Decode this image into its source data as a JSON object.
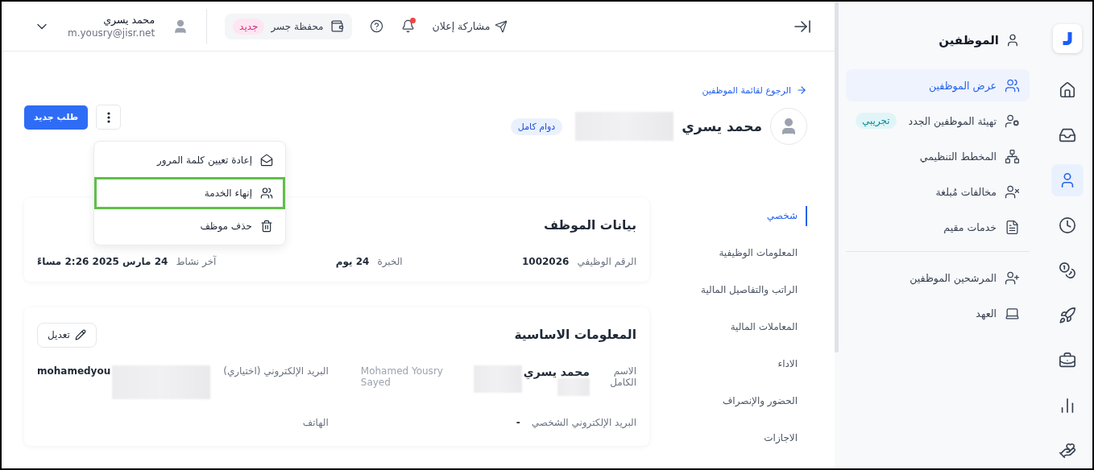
{
  "rail": {
    "items": [
      {
        "selected": false
      },
      {
        "selected": false
      },
      {
        "selected": true
      },
      {
        "selected": false
      },
      {
        "selected": false
      },
      {
        "selected": false
      },
      {
        "selected": false
      },
      {
        "selected": false
      },
      {
        "selected": false
      }
    ]
  },
  "sidebar": {
    "title": "الموظفين",
    "groups": [
      [
        {
          "label": "عرض الموظفين",
          "selected": true
        },
        {
          "label": "تهيئة الموظفين الجدد",
          "selected": false,
          "badge": "تجريبي"
        },
        {
          "label": "المخطط التنظيمي",
          "selected": false
        },
        {
          "label": "مخالفات مُبلغة",
          "selected": false
        },
        {
          "label": "خدمات مقيم",
          "selected": false
        }
      ],
      [
        {
          "label": "المرشحين الموظفين",
          "selected": false
        },
        {
          "label": "العهد",
          "selected": false
        }
      ]
    ]
  },
  "header": {
    "share": "مشاركة إعلان",
    "has_notifications": true,
    "wallet": {
      "label": "محفظة جسر",
      "badge": "جديد"
    },
    "user": {
      "name": "محمد يسري",
      "email": "m.yousry@jisr.net"
    }
  },
  "back_link": "الرجوع لقائمة الموظفين",
  "profile": {
    "name": "محمد يسري",
    "badge": "دوام كامل"
  },
  "new_request": "طلب جديد",
  "menu": {
    "items": [
      {
        "label": "إعادة تعيين كلمة المرور",
        "highlighted": false
      },
      {
        "label": "إنهاء الخدمة",
        "highlighted": true
      },
      {
        "label": "حذف موظف",
        "highlighted": false
      }
    ]
  },
  "sections": [
    {
      "label": "شخصي",
      "selected": true
    },
    {
      "label": "المعلومات الوظيفية",
      "selected": false
    },
    {
      "label": "الراتب والتفاصيل المالية",
      "selected": false
    },
    {
      "label": "المعاملات المالية",
      "selected": false
    },
    {
      "label": "الاداء",
      "selected": false
    },
    {
      "label": "الحضور والإنصراف",
      "selected": false
    },
    {
      "label": "الاجازات",
      "selected": false
    }
  ],
  "summary_card": {
    "title": "بيانات الموظف",
    "fields": [
      {
        "label": "الرقم الوظيفي",
        "value": "1002026"
      },
      {
        "label": "الخبرة",
        "value": "24 يوم"
      },
      {
        "label": "آخر نشاط",
        "value": "24 مارس 2025 2:26 مساءً"
      }
    ]
  },
  "basic_card": {
    "title": "المعلومات الاساسية",
    "edit": "تعديل",
    "fields": [
      {
        "label": "الاسم الكامل",
        "value": "محمد يسري",
        "secondary": "Mohamed Yousry Sayed",
        "redacted": true
      },
      {
        "label": "البريد الإلكتروني (اختياري)",
        "value": "mohamedyou",
        "redacted": true
      },
      {
        "label": "البريد الإلكتروني الشخصي",
        "value": "-"
      },
      {
        "label": "الهاتف"
      }
    ]
  }
}
